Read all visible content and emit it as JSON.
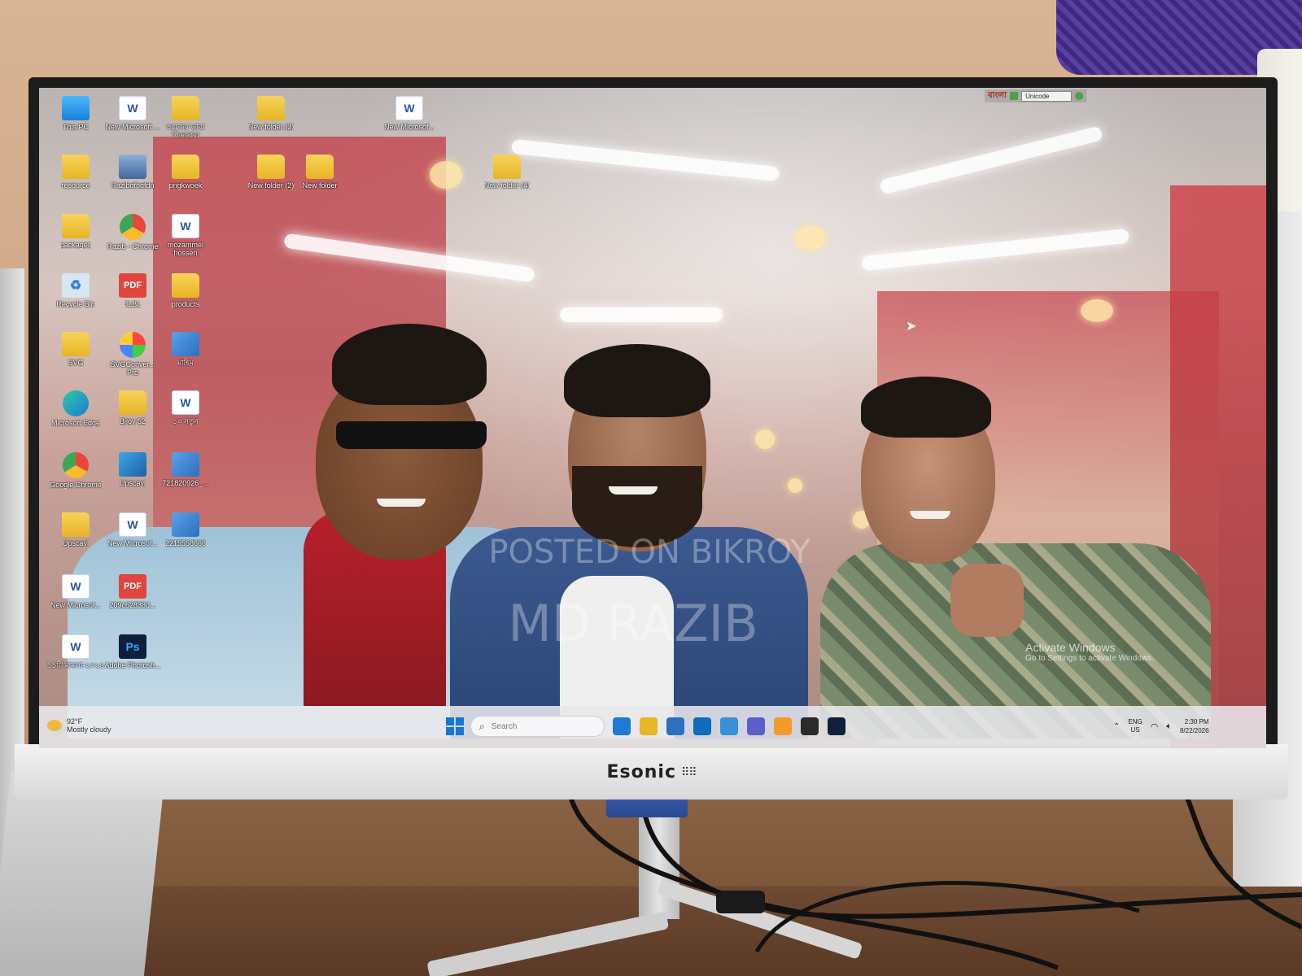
{
  "monitor": {
    "brand": "Esonic",
    "brand_dots": "⠿⠿"
  },
  "desktop": {
    "icons": [
      {
        "label": "This PC",
        "icon": "computer-icon"
      },
      {
        "label": "New Microsoft ...",
        "icon": "word-doc-icon"
      },
      {
        "label": "আজের ভারা পিডজারা",
        "icon": "folder-icon"
      },
      {
        "label": "New folder (3)",
        "icon": "folder-icon"
      },
      {
        "label": "New Microsof...",
        "icon": "word-doc-icon"
      },
      {
        "label": "resource",
        "icon": "folder-icon"
      },
      {
        "label": "Razibgfhgfdn",
        "icon": "photo-icon"
      },
      {
        "label": "pngkwoek",
        "icon": "folder-icon"
      },
      {
        "label": "New folder (2)",
        "icon": "folder-icon"
      },
      {
        "label": "New folder",
        "icon": "folder-icon"
      },
      {
        "label": "New folder (4)",
        "icon": "folder-icon"
      },
      {
        "label": "packages",
        "icon": "folder-icon"
      },
      {
        "label": "Razib - Chrome",
        "icon": "chrome-icon"
      },
      {
        "label": "mozammel hossen",
        "icon": "word-doc-icon"
      },
      {
        "label": "Recycle Bin",
        "icon": "recycle-bin-icon"
      },
      {
        "label": "JLBL",
        "icon": "pdf-icon"
      },
      {
        "label": "products",
        "icon": "folder-icon"
      },
      {
        "label": "SVG",
        "icon": "folder-icon"
      },
      {
        "label": "SVGConver... Pro",
        "icon": "svg-converter-icon"
      },
      {
        "label": "মাহিম",
        "icon": "image-icon"
      },
      {
        "label": "Microsoft Edge",
        "icon": "edge-icon"
      },
      {
        "label": "Bijoy 52",
        "icon": "folder-icon"
      },
      {
        "label": "১০ নতুন",
        "icon": "word-doc-icon"
      },
      {
        "label": "Google Chrome",
        "icon": "chrome-icon"
      },
      {
        "label": "Upscayl",
        "icon": "upscayl-icon"
      },
      {
        "label": "721820926_...",
        "icon": "image-icon"
      },
      {
        "label": "Upscayl",
        "icon": "folder-icon"
      },
      {
        "label": "New Microsof...",
        "icon": "word-doc-icon"
      },
      {
        "label": "2215558666",
        "icon": "image-icon"
      },
      {
        "label": "New Microsof...",
        "icon": "word-doc-icon"
      },
      {
        "label": "209c62838d...",
        "icon": "pdf-icon"
      },
      {
        "label": "১১টি মামলা-২০২৪",
        "icon": "word-doc-icon"
      },
      {
        "label": "Adobe Photosh...",
        "icon": "photoshop-icon"
      }
    ]
  },
  "langbar": {
    "bangla_label": "বাংলা",
    "encoding": "Unicode"
  },
  "watermark": {
    "line1": "POSTED ON BIKROY",
    "line2": "MD RAZIB"
  },
  "activation": {
    "title": "Activate Windows",
    "subtitle": "Go to Settings to activate Windows."
  },
  "taskbar": {
    "weather_temp": "92°F",
    "weather_desc": "Mostly cloudy",
    "search_placeholder": "Search",
    "lang_line1": "ENG",
    "lang_line2": "US",
    "time": "2:30 PM",
    "date": "8/22/2026",
    "pinned": [
      {
        "name": "edge-icon",
        "color": "#1c7bd6"
      },
      {
        "name": "file-explorer-icon",
        "color": "#e7b526"
      },
      {
        "name": "store-icon",
        "color": "#2d6fc0"
      },
      {
        "name": "outlook-icon",
        "color": "#0f6cbd"
      },
      {
        "name": "widgets-icon",
        "color": "#3a8fd8"
      },
      {
        "name": "teams-icon",
        "color": "#5b5fc7"
      },
      {
        "name": "copilot-icon",
        "color": "#f29b2a"
      },
      {
        "name": "obs-icon",
        "color": "#2b2b2b"
      },
      {
        "name": "photoshop-icon",
        "color": "#0f1f3d"
      }
    ]
  }
}
